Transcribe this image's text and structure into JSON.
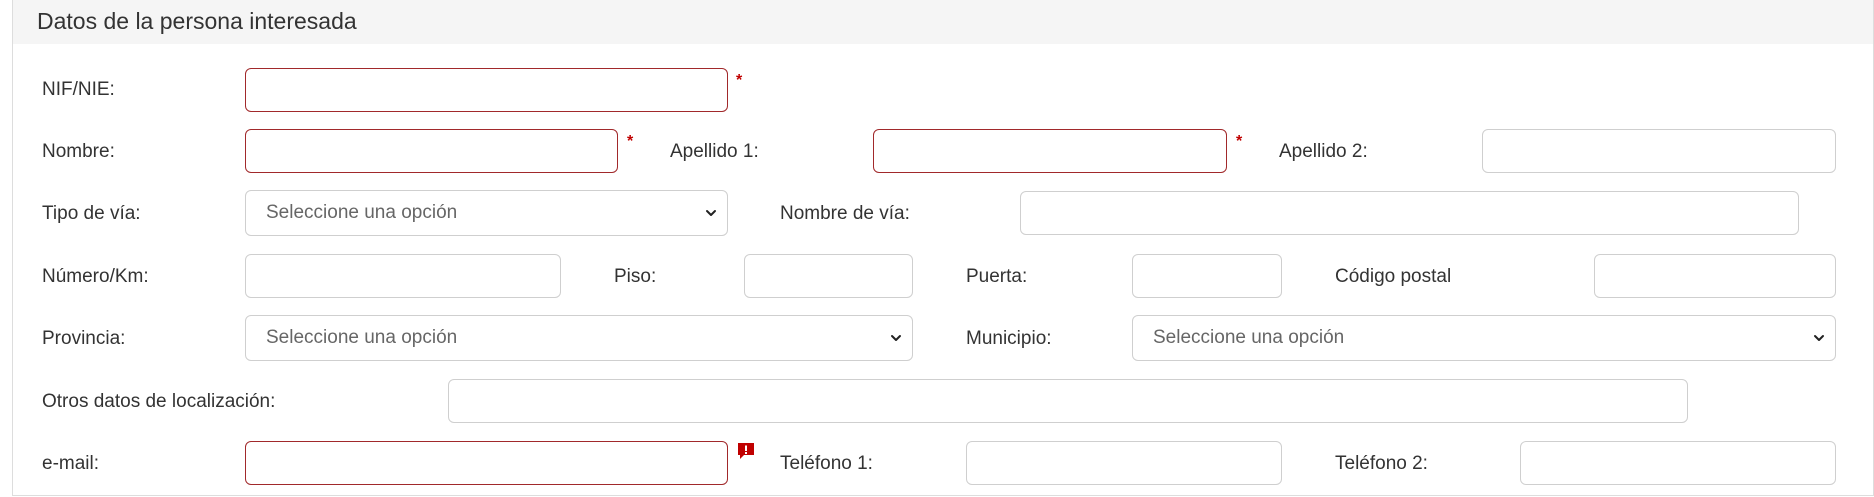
{
  "section": {
    "title": "Datos de la persona interesada"
  },
  "fields": {
    "nif": {
      "label": "NIF/NIE:",
      "value": ""
    },
    "nombre": {
      "label": "Nombre:",
      "value": ""
    },
    "apellido1": {
      "label": "Apellido 1:",
      "value": ""
    },
    "apellido2": {
      "label": "Apellido 2:",
      "value": ""
    },
    "tipo_via": {
      "label": "Tipo de vía:",
      "selected": "Seleccione una opción"
    },
    "nombre_via": {
      "label": "Nombre de vía:",
      "value": ""
    },
    "numero_km": {
      "label": "Número/Km:",
      "value": ""
    },
    "piso": {
      "label": "Piso:",
      "value": ""
    },
    "puerta": {
      "label": "Puerta:",
      "value": ""
    },
    "codigo_postal": {
      "label": "Código postal",
      "value": ""
    },
    "provincia": {
      "label": "Provincia:",
      "selected": "Seleccione una opción"
    },
    "municipio": {
      "label": "Municipio:",
      "selected": "Seleccione una opción"
    },
    "otros_datos": {
      "label": "Otros datos de localización:",
      "value": ""
    },
    "email": {
      "label": "e-mail:",
      "value": ""
    },
    "telefono1": {
      "label": "Teléfono 1:",
      "value": ""
    },
    "telefono2": {
      "label": "Teléfono 2:",
      "value": ""
    }
  },
  "required_marker": "*",
  "icons": {
    "required": "asterisk-icon",
    "validation": "warning-icon",
    "dropdown": "chevron-down-icon"
  },
  "colors": {
    "required_border": "#a1292b",
    "required_marker": "#c00000",
    "header_bg": "#f5f5f5"
  }
}
